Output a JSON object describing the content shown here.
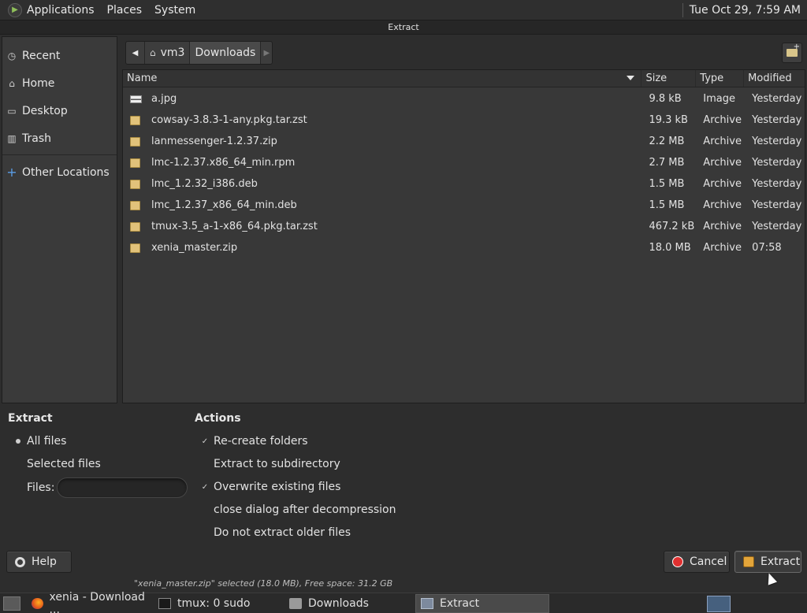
{
  "top_panel": {
    "menus": [
      "Applications",
      "Places",
      "System"
    ],
    "clock": "Tue Oct 29,  7:59 AM"
  },
  "window": {
    "title": "Extract"
  },
  "sidebar": {
    "items": [
      {
        "label": "Recent",
        "icon": "clock-icon"
      },
      {
        "label": "Home",
        "icon": "home-icon"
      },
      {
        "label": "Desktop",
        "icon": "desktop-icon"
      },
      {
        "label": "Trash",
        "icon": "trash-icon"
      },
      {
        "label": "Other Locations",
        "icon": "plus-icon"
      }
    ]
  },
  "location": {
    "crumbs": [
      "vm3",
      "Downloads"
    ],
    "active": "Downloads"
  },
  "filelist": {
    "columns": [
      "Name",
      "Size",
      "Type",
      "Modified"
    ],
    "rows": [
      {
        "name": "a.jpg",
        "size": "9.8 kB",
        "type": "Image",
        "modified": "Yesterday",
        "icon": "image-file-icon"
      },
      {
        "name": "cowsay-3.8.3-1-any.pkg.tar.zst",
        "size": "19.3 kB",
        "type": "Archive",
        "modified": "Yesterday",
        "icon": "archive-file-icon"
      },
      {
        "name": "lanmessenger-1.2.37.zip",
        "size": "2.2 MB",
        "type": "Archive",
        "modified": "Yesterday",
        "icon": "archive-file-icon"
      },
      {
        "name": "lmc-1.2.37.x86_64_min.rpm",
        "size": "2.7 MB",
        "type": "Archive",
        "modified": "Yesterday",
        "icon": "archive-file-icon"
      },
      {
        "name": "lmc_1.2.32_i386.deb",
        "size": "1.5 MB",
        "type": "Archive",
        "modified": "Yesterday",
        "icon": "archive-file-icon"
      },
      {
        "name": "lmc_1.2.37_x86_64_min.deb",
        "size": "1.5 MB",
        "type": "Archive",
        "modified": "Yesterday",
        "icon": "archive-file-icon"
      },
      {
        "name": "tmux-3.5_a-1-x86_64.pkg.tar.zst",
        "size": "467.2 kB",
        "type": "Archive",
        "modified": "Yesterday",
        "icon": "archive-file-icon"
      },
      {
        "name": "xenia_master.zip",
        "size": "18.0 MB",
        "type": "Archive",
        "modified": "07:58",
        "icon": "archive-file-icon"
      }
    ]
  },
  "extract_options": {
    "title": "Extract",
    "all_files": "All files",
    "selected_files": "Selected files",
    "files_label": "Files:",
    "files_value": "",
    "selected": "All files"
  },
  "actions": {
    "title": "Actions",
    "items": [
      {
        "label": "Re-create folders",
        "checked": true
      },
      {
        "label": "Extract to subdirectory",
        "checked": false
      },
      {
        "label": "Overwrite existing files",
        "checked": true
      },
      {
        "label": "close dialog after decompression",
        "checked": false
      },
      {
        "label": "Do not extract older files",
        "checked": false
      }
    ]
  },
  "buttons": {
    "help": "Help",
    "cancel": "Cancel",
    "extract": "Extract"
  },
  "status": "\"xenia_master.zip\" selected (18.0 MB), Free space: 31.2 GB",
  "taskbar": {
    "tasks": [
      {
        "label": "xenia - Download ...",
        "icon": "firefox-icon"
      },
      {
        "label": "tmux: 0 sudo",
        "icon": "terminal-icon"
      },
      {
        "label": "Downloads",
        "icon": "folder-icon"
      },
      {
        "label": "Extract",
        "icon": "archive-manager-icon",
        "active": true
      }
    ]
  }
}
